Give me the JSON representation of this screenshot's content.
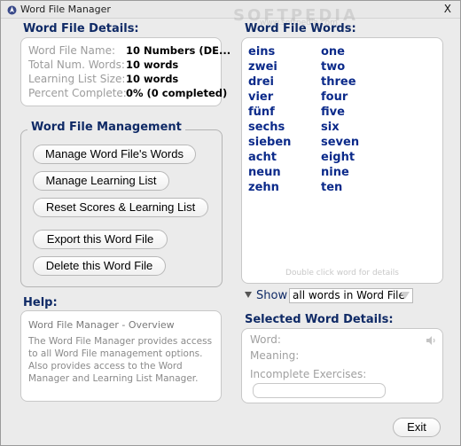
{
  "window": {
    "title": "Word File Manager",
    "close_glyph": "X",
    "watermark": "SOFTPEDIA",
    "watermark_url": "www.softpedia.com"
  },
  "details": {
    "heading": "Word File Details:",
    "rows": [
      {
        "label": "Word File Name:",
        "value": "10 Numbers (DE..."
      },
      {
        "label": "Total Num. Words:",
        "value": "10 words"
      },
      {
        "label": "Learning List Size:",
        "value": "10 words"
      },
      {
        "label": "Percent Complete:",
        "value": "0% (0 completed)"
      }
    ]
  },
  "management": {
    "heading": "Word File Management",
    "buttons": [
      "Manage Word File's Words",
      "Manage Learning List",
      "Reset Scores & Learning List",
      "Export this Word File",
      "Delete this Word File"
    ]
  },
  "help": {
    "heading": "Help:",
    "title": "Word File Manager - Overview",
    "body": "The Word File Manager provides access to all Word File management options. Also provides access to the Word Manager and Learning List Manager."
  },
  "words": {
    "heading": "Word File Words:",
    "hint": "Double click word for details",
    "pairs": [
      {
        "de": "eins",
        "en": "one"
      },
      {
        "de": "zwei",
        "en": "two"
      },
      {
        "de": "drei",
        "en": "three"
      },
      {
        "de": "vier",
        "en": "four"
      },
      {
        "de": "fünf",
        "en": "five"
      },
      {
        "de": "sechs",
        "en": "six"
      },
      {
        "de": "sieben",
        "en": "seven"
      },
      {
        "de": "acht",
        "en": "eight"
      },
      {
        "de": "neun",
        "en": "nine"
      },
      {
        "de": "zehn",
        "en": "ten"
      }
    ]
  },
  "show": {
    "label": "Show",
    "selected": "all words in Word File"
  },
  "selected_word": {
    "heading": "Selected Word Details:",
    "word_label": "Word:",
    "meaning_label": "Meaning:",
    "exercises_label": "Incomplete Exercises:",
    "exercises_value": ""
  },
  "footer": {
    "exit_label": "Exit"
  },
  "colors": {
    "heading": "#0f2a66",
    "word_text": "#0b2a8a",
    "label_grey": "#9c9c9c",
    "window_bg": "#ebebeb"
  },
  "icons": {
    "app": "app-icon",
    "sound": "speaker-icon",
    "show_toggle": "collapse-triangle-icon",
    "dropdown": "dropdown-arrow-icon"
  }
}
